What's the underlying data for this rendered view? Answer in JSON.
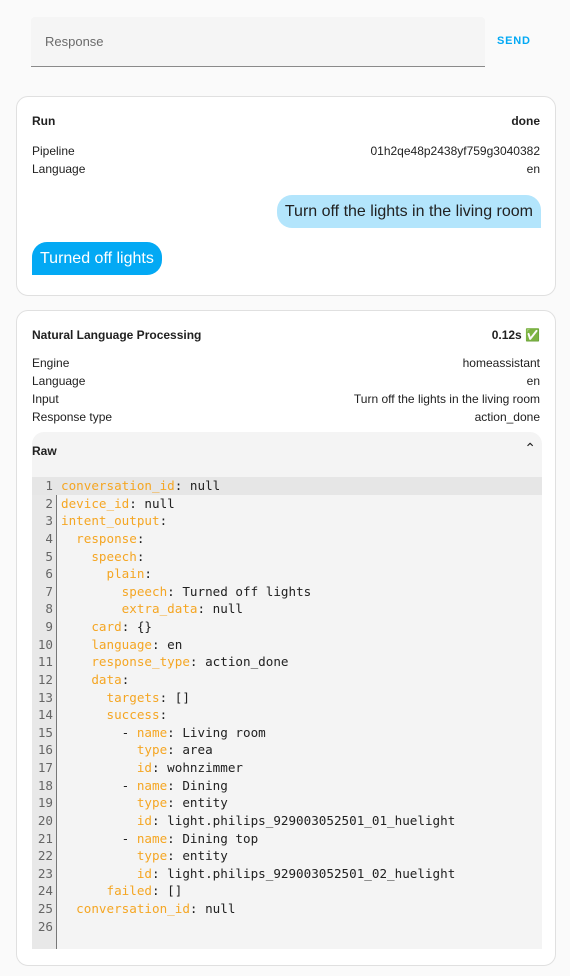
{
  "input": {
    "placeholder": "Response",
    "send_label": "SEND"
  },
  "run": {
    "title": "Run",
    "status": "done",
    "rows": [
      {
        "label": "Pipeline",
        "value": "01h2qe48p2438yf759g3040382"
      },
      {
        "label": "Language",
        "value": "en"
      }
    ],
    "user_message": "Turn off the lights in the living room",
    "agent_message": "Turned off lights"
  },
  "nlp": {
    "title": "Natural Language Processing",
    "duration": "0.12s ✅",
    "rows": [
      {
        "label": "Engine",
        "value": "homeassistant"
      },
      {
        "label": "Language",
        "value": "en"
      },
      {
        "label": "Input",
        "value": "Turn off the lights in the living room"
      },
      {
        "label": "Response type",
        "value": "action_done"
      }
    ],
    "raw": {
      "title": "Raw",
      "lines": [
        [
          "",
          "conversation_id",
          ": null"
        ],
        [
          "",
          "device_id",
          ": null"
        ],
        [
          "",
          "intent_output",
          ":"
        ],
        [
          "  ",
          "response",
          ":"
        ],
        [
          "    ",
          "speech",
          ":"
        ],
        [
          "      ",
          "plain",
          ":"
        ],
        [
          "        ",
          "speech",
          ": Turned off lights"
        ],
        [
          "        ",
          "extra_data",
          ": null"
        ],
        [
          "    ",
          "card",
          ": {}"
        ],
        [
          "    ",
          "language",
          ": en"
        ],
        [
          "    ",
          "response_type",
          ": action_done"
        ],
        [
          "    ",
          "data",
          ":"
        ],
        [
          "      ",
          "targets",
          ": []"
        ],
        [
          "      ",
          "success",
          ":"
        ],
        [
          "        - ",
          "name",
          ": Living room"
        ],
        [
          "          ",
          "type",
          ": area"
        ],
        [
          "          ",
          "id",
          ": wohnzimmer"
        ],
        [
          "        - ",
          "name",
          ": Dining"
        ],
        [
          "          ",
          "type",
          ": entity"
        ],
        [
          "          ",
          "id",
          ": light.philips_929003052501_01_huelight"
        ],
        [
          "        - ",
          "name",
          ": Dining top"
        ],
        [
          "          ",
          "type",
          ": entity"
        ],
        [
          "          ",
          "id",
          ": light.philips_929003052501_02_huelight"
        ],
        [
          "      ",
          "failed",
          ": []"
        ],
        [
          "  ",
          "conversation_id",
          ": null"
        ],
        [
          "",
          "",
          ""
        ]
      ]
    }
  }
}
